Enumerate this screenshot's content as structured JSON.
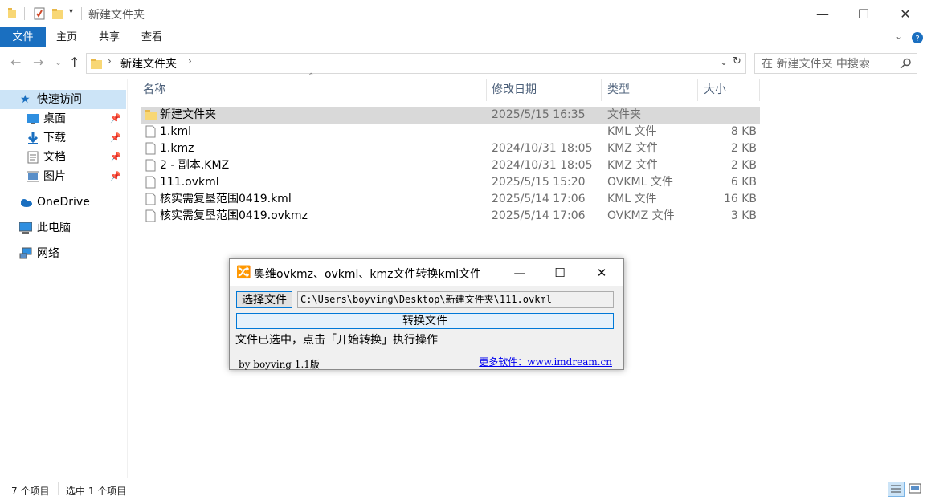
{
  "window": {
    "title": "新建文件夹",
    "minimize": "—",
    "maximize": "☐",
    "close": "✕"
  },
  "ribbon": {
    "tabs": [
      "文件",
      "主页",
      "共享",
      "查看"
    ]
  },
  "address": {
    "crumb": "新建文件夹",
    "search_placeholder": "在 新建文件夹 中搜索"
  },
  "sidebar": {
    "items": [
      {
        "label": "快速访问",
        "icon": "star-icon"
      },
      {
        "label": "桌面",
        "icon": "desktop-icon"
      },
      {
        "label": "下载",
        "icon": "download-icon"
      },
      {
        "label": "文档",
        "icon": "document-icon"
      },
      {
        "label": "图片",
        "icon": "pictures-icon"
      },
      {
        "label": "OneDrive",
        "icon": "cloud-icon"
      },
      {
        "label": "此电脑",
        "icon": "computer-icon"
      },
      {
        "label": "网络",
        "icon": "network-icon"
      }
    ]
  },
  "columns": {
    "name": "名称",
    "date": "修改日期",
    "type": "类型",
    "size": "大小"
  },
  "files": [
    {
      "name": "新建文件夹",
      "date": "2025/5/15 16:35",
      "type": "文件夹",
      "size": "",
      "kind": "folder"
    },
    {
      "name": "1.kml",
      "date": "",
      "type": "KML 文件",
      "size": "8 KB",
      "kind": "file"
    },
    {
      "name": "1.kmz",
      "date": "2024/10/31 18:05",
      "type": "KMZ 文件",
      "size": "2 KB",
      "kind": "file"
    },
    {
      "name": "2 - 副本.KMZ",
      "date": "2024/10/31 18:05",
      "type": "KMZ 文件",
      "size": "2 KB",
      "kind": "file"
    },
    {
      "name": "111.ovkml",
      "date": "2025/5/15 15:20",
      "type": "OVKML 文件",
      "size": "6 KB",
      "kind": "file"
    },
    {
      "name": "核实需复垦范围0419.kml",
      "date": "2025/5/14 17:06",
      "type": "KML 文件",
      "size": "16 KB",
      "kind": "file"
    },
    {
      "name": "核实需复垦范围0419.ovkmz",
      "date": "2025/5/14 17:06",
      "type": "OVKMZ 文件",
      "size": "3 KB",
      "kind": "file"
    }
  ],
  "status": {
    "count": "7 个项目",
    "selected": "选中 1 个项目"
  },
  "dialog": {
    "title": "奥维ovkmz、ovkml、kmz文件转换kml文件",
    "choose_label": "选择文件",
    "path": "C:\\Users\\boyving\\Desktop\\新建文件夹\\111.ovkml",
    "convert_label": "转换文件",
    "message": "文件已选中，点击「开始转换」执行操作",
    "version": "by boyving 1.1版",
    "link": "更多软件：www.imdream.cn"
  },
  "colors": {
    "accent": "#1a6fc0",
    "selection": "#cce4f7",
    "row_selected": "#d9d9d9",
    "folder": "#f8d775",
    "link": "#0000ee"
  }
}
